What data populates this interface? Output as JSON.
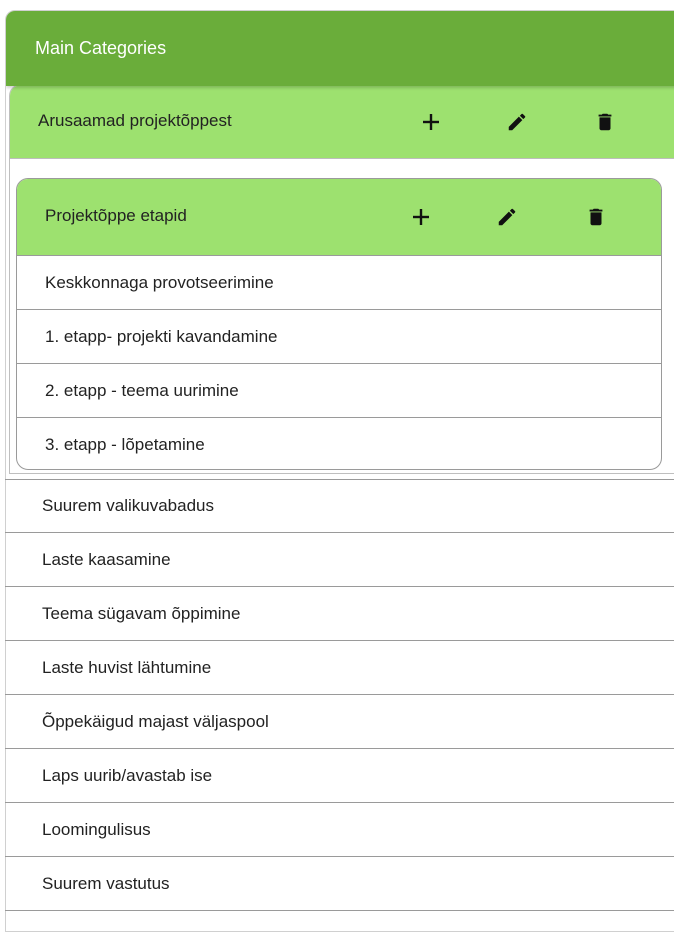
{
  "main_header": {
    "title": "Main Categories"
  },
  "category": {
    "title": "Arusaamad projektõppest",
    "subcategory": {
      "title": "Projektõppe etapid",
      "items": [
        "Keskkonnaga provotseerimine",
        "1. etapp- projekti kavandamine",
        "2. etapp - teema uurimine",
        "3. etapp - lõpetamine"
      ]
    }
  },
  "items": [
    "Suurem valikuvabadus",
    "Laste kaasamine",
    "Teema sügavam õppimine",
    "Laste huvist lähtumine",
    "Õppekäigud majast väljaspool",
    "Laps uurib/avastab ise",
    "Loomingulisus",
    "Suurem vastutus"
  ],
  "icons": {
    "add": "plus-icon",
    "edit": "pencil-icon",
    "delete": "trash-icon"
  },
  "colors": {
    "header_dark_green": "#6aad3a",
    "header_light_green": "#9de16f"
  }
}
